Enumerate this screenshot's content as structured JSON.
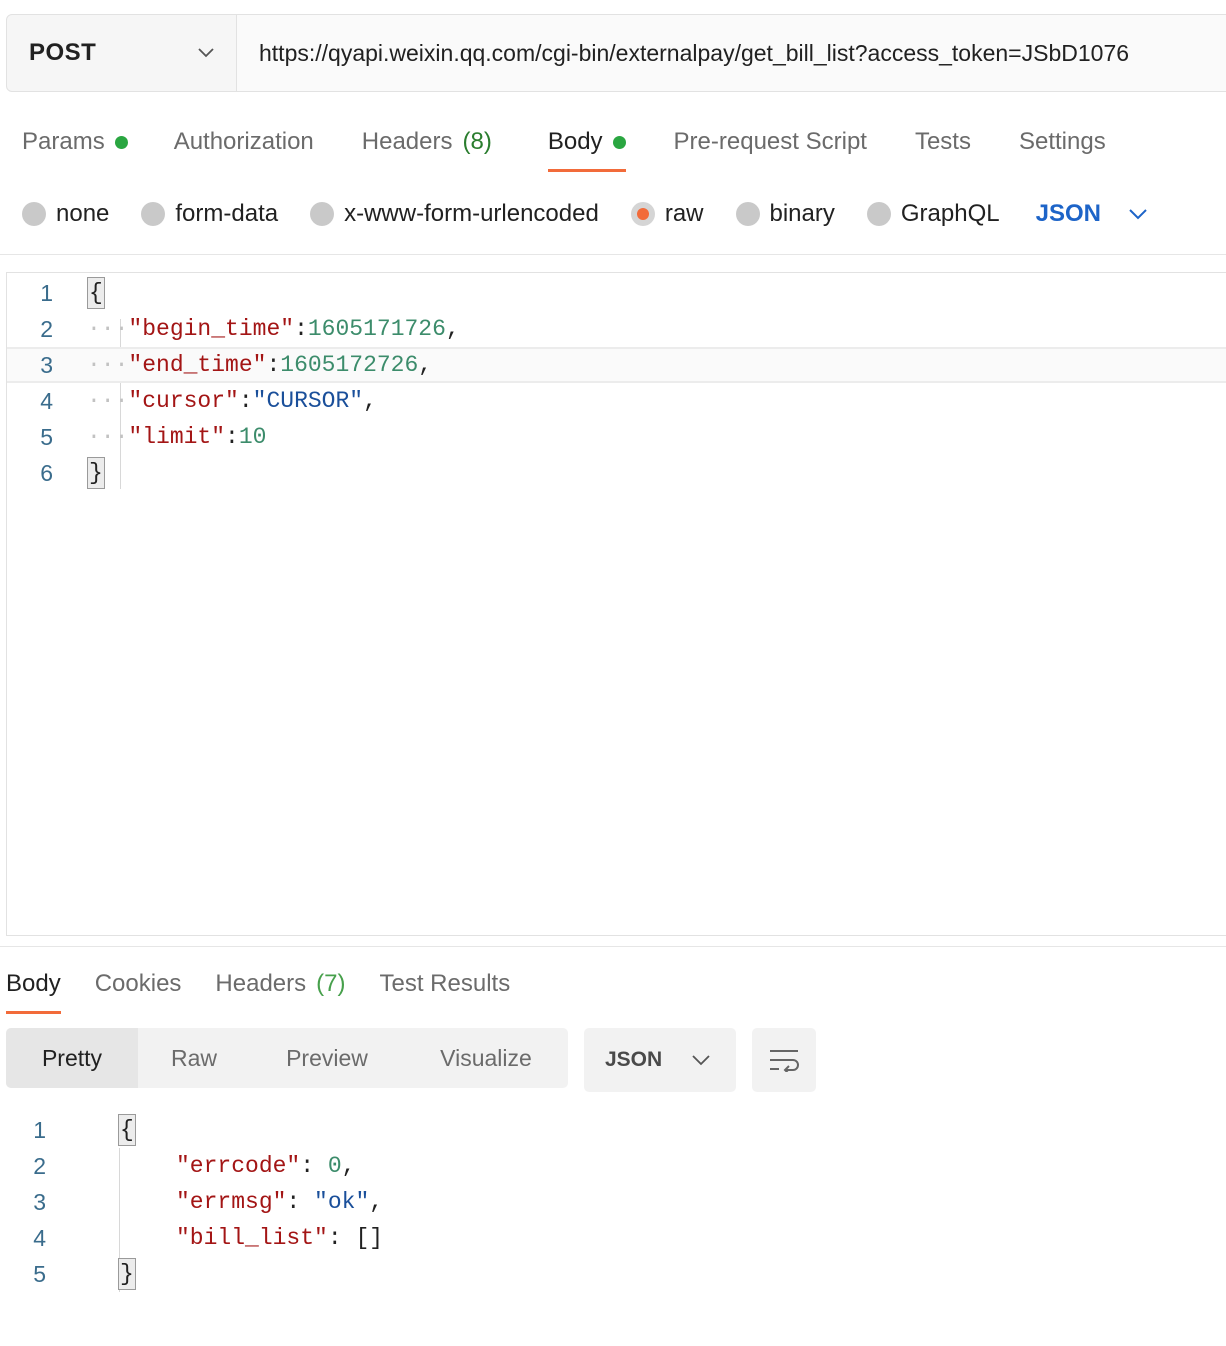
{
  "request": {
    "method": "POST",
    "url": "https://qyapi.weixin.qq.com/cgi-bin/externalpay/get_bill_list?access_token=JSbD1076"
  },
  "request_tabs": [
    {
      "label": "Params",
      "dot": true
    },
    {
      "label": "Authorization"
    },
    {
      "label": "Headers",
      "count": "(8)"
    },
    {
      "label": "Body",
      "dot": true,
      "active": true
    },
    {
      "label": "Pre-request Script"
    },
    {
      "label": "Tests"
    },
    {
      "label": "Settings"
    }
  ],
  "body_types": {
    "options": [
      "none",
      "form-data",
      "x-www-form-urlencoded",
      "raw",
      "binary",
      "GraphQL"
    ],
    "selected": "raw",
    "language": "JSON"
  },
  "request_body": {
    "line_numbers": [
      "1",
      "2",
      "3",
      "4",
      "5",
      "6"
    ],
    "open_brace": "{",
    "close_brace": "}",
    "dots": "···",
    "begin_time_key": "\"begin_time\"",
    "begin_time_value": "1605171726",
    "end_time_key": "\"end_time\"",
    "end_time_value": "1605172726",
    "cursor_key": "\"cursor\"",
    "cursor_value": "\"CURSOR\"",
    "limit_key": "\"limit\"",
    "limit_value": "10"
  },
  "response_tabs": [
    {
      "label": "Body",
      "active": true
    },
    {
      "label": "Cookies"
    },
    {
      "label": "Headers",
      "count": "(7)"
    },
    {
      "label": "Test Results"
    }
  ],
  "response_view": {
    "modes": [
      "Pretty",
      "Raw",
      "Preview",
      "Visualize"
    ],
    "selected": "Pretty",
    "format": "JSON",
    "wrap_icon": "wrap-lines-icon"
  },
  "response_body": {
    "line_numbers": [
      "1",
      "2",
      "3",
      "4",
      "5"
    ],
    "open_brace": "{",
    "close_brace": "}",
    "errcode_key": "\"errcode\"",
    "errcode_value": "0",
    "errmsg_key": "\"errmsg\"",
    "errmsg_value": "\"ok\"",
    "bill_list_key": "\"bill_list\"",
    "bill_list_value": "[]"
  },
  "colors": {
    "accent": "#f26b3a",
    "status_green": "#2aa641",
    "link_blue": "#1d64c8",
    "json_key": "#a31515",
    "json_number": "#3c8c6b",
    "json_string": "#1a4f9a"
  }
}
